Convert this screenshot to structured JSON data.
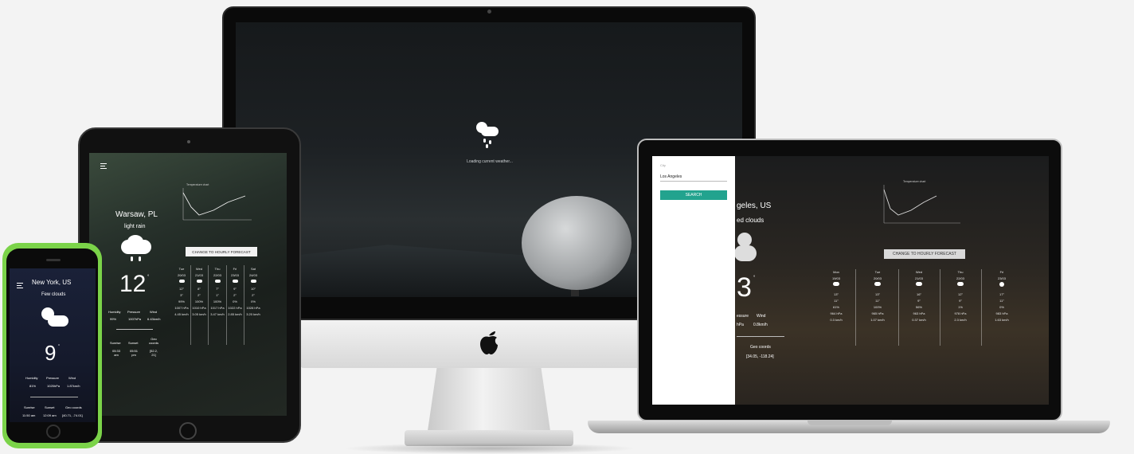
{
  "imac": {
    "loading_text": "Loading current weather..."
  },
  "ipad": {
    "city": "Warsaw, PL",
    "description": "light rain",
    "temperature": "12",
    "degree": "°",
    "stats_labels": [
      "Humidity",
      "Pressure",
      "Wind"
    ],
    "stats_values": [
      "99%",
      "1007hPa",
      "6.43km/h"
    ],
    "sun_labels": [
      "Sunrise",
      "Sunset",
      "Geo coords"
    ],
    "sun_values": [
      "05:33 am",
      "05:51 pm",
      "[52.2, 21]"
    ],
    "hourly_button": "CHANGE TO HOURLY FORECAST",
    "chart_title": "Temperature chart",
    "forecast": [
      {
        "day": "Tue",
        "date": "20/03",
        "temp": "12°",
        "min": "3°",
        "hum": "99%",
        "pres": "1007 hPa",
        "wind": "4.45 km/h"
      },
      {
        "day": "Wed",
        "date": "21/03",
        "temp": "8°",
        "min": "2°",
        "hum": "100%",
        "pres": "1010 hPa",
        "wind": "3.05 km/h"
      },
      {
        "day": "Thu",
        "date": "22/03",
        "temp": "7°",
        "min": "1°",
        "hum": "100%",
        "pres": "1017 hPa",
        "wind": "3.47 km/h"
      },
      {
        "day": "Fri",
        "date": "23/03",
        "temp": "9°",
        "min": "2°",
        "hum": "0%",
        "pres": "1022 hPa",
        "wind": "2.85 km/h"
      },
      {
        "day": "Sat",
        "date": "24/03",
        "temp": "10°",
        "min": "2°",
        "hum": "0%",
        "pres": "1028 hPa",
        "wind": "3.20 km/h"
      }
    ]
  },
  "iphone": {
    "city": "New York, US",
    "description": "Few clouds",
    "temperature": "9",
    "degree": "°",
    "stats_labels": [
      "Humidity",
      "Pressure",
      "Wind"
    ],
    "stats_values": [
      "81%",
      "1025hPa",
      "1.87km/h"
    ],
    "sun_labels": [
      "Sunrise",
      "Sunset",
      "Geo coords"
    ],
    "sun_values": [
      "11:50 am",
      "12:09 am",
      "[40.71, -74.01]"
    ]
  },
  "macbook": {
    "search_label": "City",
    "search_value": "Los Angeles",
    "search_button": "SEARCH",
    "city": "geles, US",
    "description": "ed clouds",
    "temperature": "3",
    "degree": "°",
    "stats_labels": [
      "essure",
      "Wind"
    ],
    "stats_values": [
      "hPa",
      "0.8km/h"
    ],
    "geo_label": "Geo coords",
    "geo_value": "[34.05, -118.24]",
    "hourly_button": "CHANGE TO HOURLY FORECAST",
    "chart_title": "Temperature chart",
    "forecast": [
      {
        "day": "Mon",
        "date": "19/03",
        "temp": "13°",
        "min": "11°",
        "hum": "61%",
        "pres": "964 hPa",
        "wind": "0.3 km/h"
      },
      {
        "day": "Tue",
        "date": "20/03",
        "temp": "13°",
        "min": "11°",
        "hum": "100%",
        "pres": "965 hPa",
        "wind": "1.07 km/h"
      },
      {
        "day": "Wed",
        "date": "21/03",
        "temp": "16°",
        "min": "9°",
        "hum": "56%",
        "pres": "963 hPa",
        "wind": "0.37 km/h"
      },
      {
        "day": "Thu",
        "date": "22/03",
        "temp": "12°",
        "min": "9°",
        "hum": "1%",
        "pres": "978 hPa",
        "wind": "2.3 km/h"
      },
      {
        "day": "Fri",
        "date": "23/03",
        "temp": "17°",
        "min": "11°",
        "hum": "0%",
        "pres": "983 hPa",
        "wind": "1.63 km/h"
      }
    ]
  }
}
